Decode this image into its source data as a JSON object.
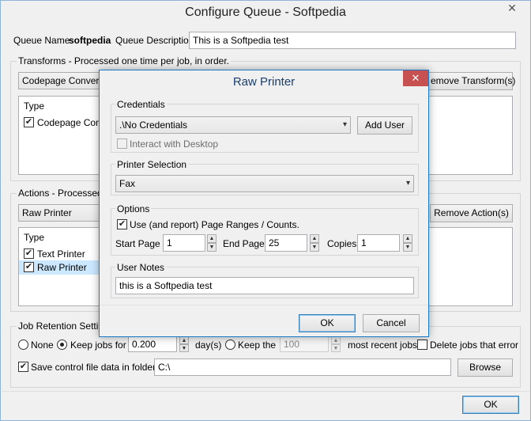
{
  "window": {
    "title": "Configure Queue - Softpedia",
    "close_glyph": "✕"
  },
  "queue": {
    "name_label": "Queue Name",
    "name_value": "softpedia",
    "desc_label": "Queue Description",
    "desc_value": "This is a Softpedia test"
  },
  "transforms": {
    "group_label": "Transforms - Processed one time per job, in order.",
    "combo_value": "Codepage Conversio",
    "remove_label": "emove Transform(s)",
    "column_type": "Type",
    "items": [
      {
        "label": "Codepage Conve",
        "checked": true
      }
    ]
  },
  "actions": {
    "group_label": "Actions - Processed i",
    "combo_value": "Raw Printer",
    "remove_label": "Remove Action(s)",
    "column_type": "Type",
    "items": [
      {
        "label": "Text Printer",
        "checked": true
      },
      {
        "label": "Raw Printer",
        "checked": true
      }
    ]
  },
  "retention": {
    "group_label": "Job Retention Setting",
    "none_label": "None",
    "keep_for_label": "Keep jobs for",
    "keep_for_value": "0.200",
    "days_label": "day(s)",
    "keep_the_label": "Keep the",
    "keep_the_value": "100",
    "recent_label": "most recent jobs",
    "delete_error_label": "Delete jobs that error"
  },
  "control": {
    "save_label": "Save control file data in folder:",
    "folder_value": "C:\\",
    "browse_label": "Browse"
  },
  "footer": {
    "ok_label": "OK"
  },
  "modal": {
    "title": "Raw Printer",
    "close_glyph": "✕",
    "credentials_label": "Credentials",
    "credentials_value": ".\\No Credentials",
    "add_user_label": "Add User",
    "interact_label": "Interact with Desktop",
    "printer_label": "Printer Selection",
    "printer_value": "Fax",
    "options_label": "Options",
    "use_ranges_label": "Use (and report) Page Ranges / Counts.",
    "start_page_label": "Start Page",
    "start_page_value": "1",
    "end_page_label": "End Page",
    "end_page_value": "25",
    "copies_label": "Copies",
    "copies_value": "1",
    "notes_label": "User Notes",
    "notes_value": "this is a Softpedia test",
    "ok_label": "OK",
    "cancel_label": "Cancel"
  },
  "icons": {
    "check": "✔",
    "dropdown": "▾",
    "spin_up": "▲",
    "spin_down": "▼"
  }
}
